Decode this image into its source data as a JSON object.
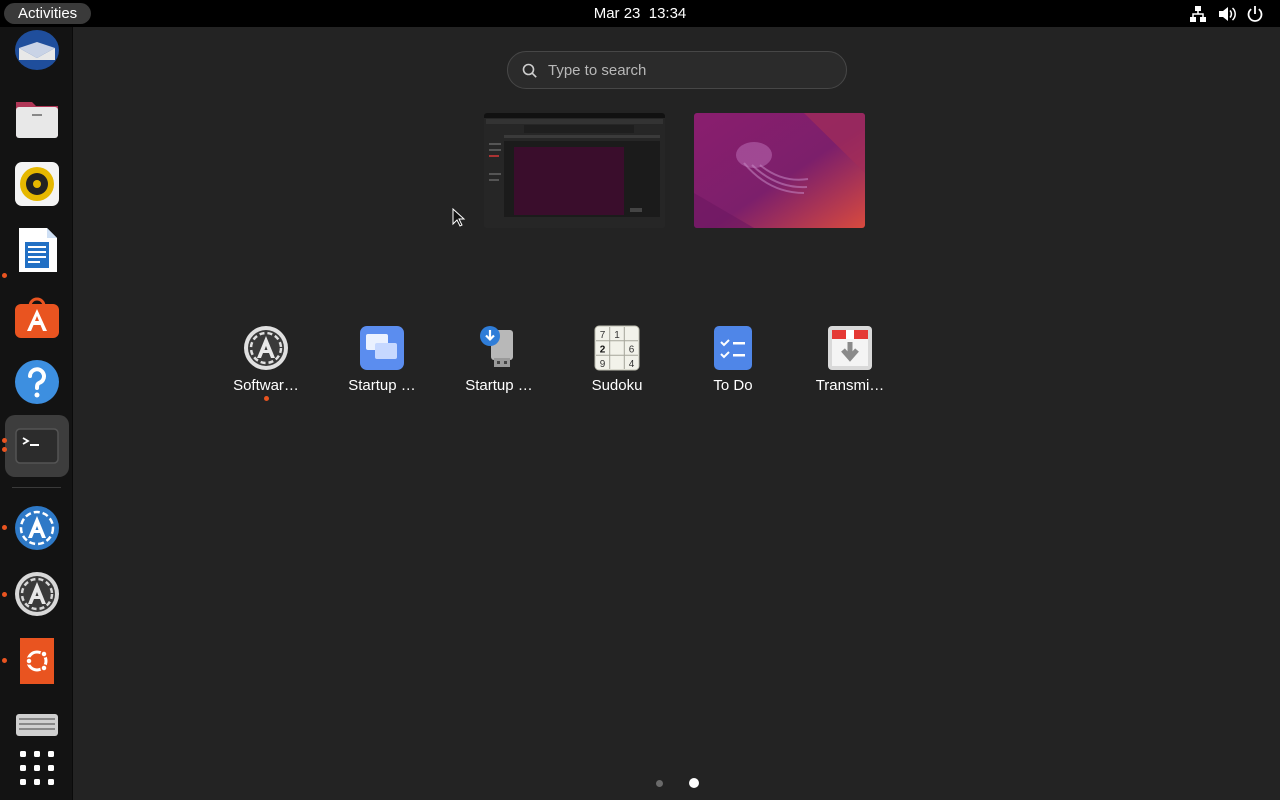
{
  "topbar": {
    "activities": "Activities",
    "date": "Mar 23",
    "time": "13:34",
    "tray": [
      "network-icon",
      "volume-icon",
      "power-icon"
    ]
  },
  "dock": {
    "items": [
      {
        "name": "Thunderbird Mail",
        "icon": "mail-icon",
        "running": false
      },
      {
        "name": "Files",
        "icon": "files-icon",
        "running": false
      },
      {
        "name": "Rhythmbox",
        "icon": "rhythmbox-icon",
        "running": false
      },
      {
        "name": "LibreOffice Writer",
        "icon": "writer-icon",
        "running": true
      },
      {
        "name": "Ubuntu Software",
        "icon": "app-store-icon",
        "running": false
      },
      {
        "name": "Help",
        "icon": "help-icon",
        "running": false
      },
      {
        "name": "Terminal",
        "icon": "terminal-icon",
        "running": true,
        "active": true
      },
      {
        "name": "Software Updater",
        "icon": "software-updater-icon",
        "running": true
      },
      {
        "name": "Software & Updates",
        "icon": "software-properties-icon",
        "running": true
      },
      {
        "name": "Ubuntu Installer",
        "icon": "ubuntu-icon",
        "running": true
      },
      {
        "name": "Removable Drive",
        "icon": "drive-icon",
        "running": false
      },
      {
        "name": "Show Applications",
        "icon": "app-grid-icon",
        "running": false
      }
    ]
  },
  "search": {
    "placeholder": "Type to search"
  },
  "workspaces": [
    {
      "name": "workspace-1",
      "content": "terminal window"
    },
    {
      "name": "workspace-2",
      "content": "wallpaper"
    }
  ],
  "apps": [
    {
      "label": "Softwar…",
      "icon": "software-properties-icon",
      "running": true
    },
    {
      "label": "Startup …",
      "icon": "startup-apps-icon",
      "running": false
    },
    {
      "label": "Startup …",
      "icon": "startup-disk-icon",
      "running": false
    },
    {
      "label": "Sudoku",
      "icon": "sudoku-icon",
      "running": false,
      "digits": [
        "7",
        "1",
        "2",
        "6",
        "9",
        "4"
      ]
    },
    {
      "label": "To Do",
      "icon": "todo-icon",
      "running": false
    },
    {
      "label": "Transmi…",
      "icon": "transmission-icon",
      "running": false
    }
  ],
  "pagination": {
    "pages": 2,
    "current": 2
  },
  "colors": {
    "accent": "#e95420",
    "background": "#232323",
    "topbar": "#000000",
    "dock": "#131313"
  }
}
